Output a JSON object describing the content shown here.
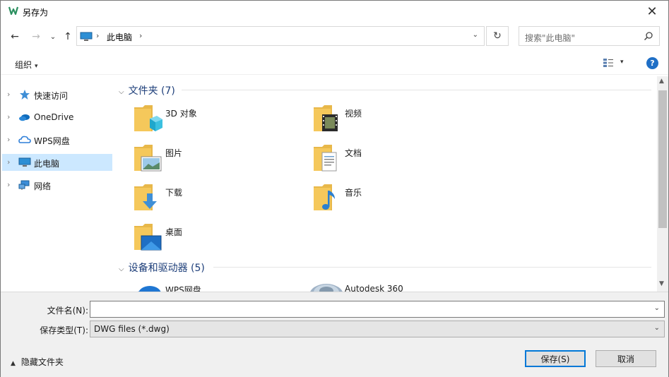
{
  "window": {
    "title": "另存为",
    "close_glyph": "✕"
  },
  "nav": {
    "back_glyph": "←",
    "forward_glyph": "→",
    "recent_glyph": "⌄",
    "up_glyph": "↑",
    "breadcrumb_sep": "›",
    "breadcrumb": [
      "此电脑"
    ],
    "address_dropdown_glyph": "⌄",
    "refresh_glyph": "↻",
    "search_placeholder": "搜索\"此电脑\""
  },
  "toolbar": {
    "organize_label": "组织",
    "caret": "▾",
    "help_glyph": "?"
  },
  "sidebar": {
    "items": [
      {
        "label": "快速访问",
        "icon": "star-icon",
        "selected": false
      },
      {
        "label": "OneDrive",
        "icon": "cloud-icon",
        "selected": false
      },
      {
        "label": "WPS网盘",
        "icon": "wps-cloud-icon",
        "selected": false
      },
      {
        "label": "此电脑",
        "icon": "pc-icon",
        "selected": true
      },
      {
        "label": "网络",
        "icon": "network-icon",
        "selected": false
      }
    ],
    "chevron": "›"
  },
  "content": {
    "groups": [
      {
        "label": "文件夹 (7)",
        "chevron": "⌵"
      },
      {
        "label": "设备和驱动器 (5)",
        "chevron": "⌵"
      }
    ],
    "folders": [
      {
        "label": "3D 对象",
        "icon": "3d-objects-folder-icon"
      },
      {
        "label": "视频",
        "icon": "videos-folder-icon"
      },
      {
        "label": "图片",
        "icon": "pictures-folder-icon"
      },
      {
        "label": "文档",
        "icon": "documents-folder-icon"
      },
      {
        "label": "下载",
        "icon": "downloads-folder-icon"
      },
      {
        "label": "音乐",
        "icon": "music-folder-icon"
      },
      {
        "label": "桌面",
        "icon": "desktop-folder-icon"
      }
    ],
    "devices": [
      {
        "label": "WPS网盘",
        "icon": "wps-cloud-drive-icon"
      },
      {
        "label": "Autodesk 360",
        "icon": "autodesk-360-icon"
      }
    ]
  },
  "scrollbar": {
    "up_glyph": "▲",
    "down_glyph": "▼"
  },
  "form": {
    "filename_label": "文件名(N):",
    "filename_value": "",
    "dropdown_glyph": "⌄",
    "filetype_label": "保存类型(T):",
    "filetype_value": "DWG files (*.dwg)"
  },
  "footer": {
    "hide_folders_label": "隐藏文件夹",
    "hide_caret": "▲",
    "save_label": "保存(S)",
    "cancel_label": "取消"
  },
  "colors": {
    "accent": "#0078d7",
    "selected_bg": "#cce8ff",
    "group_header": "#1e3f7a",
    "folder_yellow": "#f5c85b"
  }
}
